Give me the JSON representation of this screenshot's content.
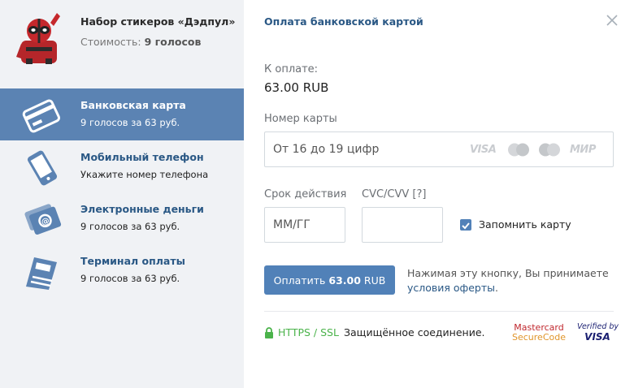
{
  "product": {
    "title": "Набор стикеров «Дэдпул»",
    "cost_label": "Стоимость:",
    "cost_value": "9 голосов",
    "image_icon": "deadpool-sticker-icon"
  },
  "methods": [
    {
      "title": "Банковская карта",
      "subtitle": "9 голосов за 63 руб.",
      "icon": "bank-card-icon",
      "active": true
    },
    {
      "title": "Мобильный телефон",
      "subtitle": "Укажите номер телефона",
      "icon": "mobile-phone-icon",
      "active": false
    },
    {
      "title": "Электронные деньги",
      "subtitle": "9 голосов за 63 руб.",
      "icon": "e-money-icon",
      "active": false
    },
    {
      "title": "Терминал оплаты",
      "subtitle": "9 голосов за 63 руб.",
      "icon": "payment-terminal-icon",
      "active": false
    }
  ],
  "payment": {
    "title": "Оплата банковской картой",
    "close_icon": "close-icon",
    "amount_label": "К оплате:",
    "amount_value": "63.00 RUB",
    "card_label": "Номер карты",
    "card_placeholder": "От 16 до 19 цифр",
    "card_brands": {
      "visa": "VISA",
      "mir": "МИР",
      "mastercard_icon": "mastercard-icon",
      "maestro_icon": "maestro-icon"
    },
    "expiry_label": "Срок действия",
    "expiry_placeholder": "ММ/ГГ",
    "cvc_label": "CVC/CVV [?]",
    "remember_label": "Запомнить карту",
    "remember_checked": true,
    "pay_button_prefix": "Оплатить ",
    "pay_button_amount": "63.00",
    "pay_button_suffix": " RUB",
    "agree_line1": "Нажимая эту кнопку, Вы принимаете",
    "agree_link": "условия оферты",
    "agree_end": ".",
    "ssl_label": "HTTPS / SSL",
    "ssl_text": "Защищённое соединение.",
    "mc_secure_a": "Mastercard",
    "mc_secure_b": "SecureCode",
    "verified_a": "Verified by",
    "verified_b": "VISA"
  },
  "colors": {
    "accent": "#5181b8",
    "active_method_bg": "#5b83b3",
    "link": "#2a5885",
    "ssl_green": "#4bb34b"
  }
}
